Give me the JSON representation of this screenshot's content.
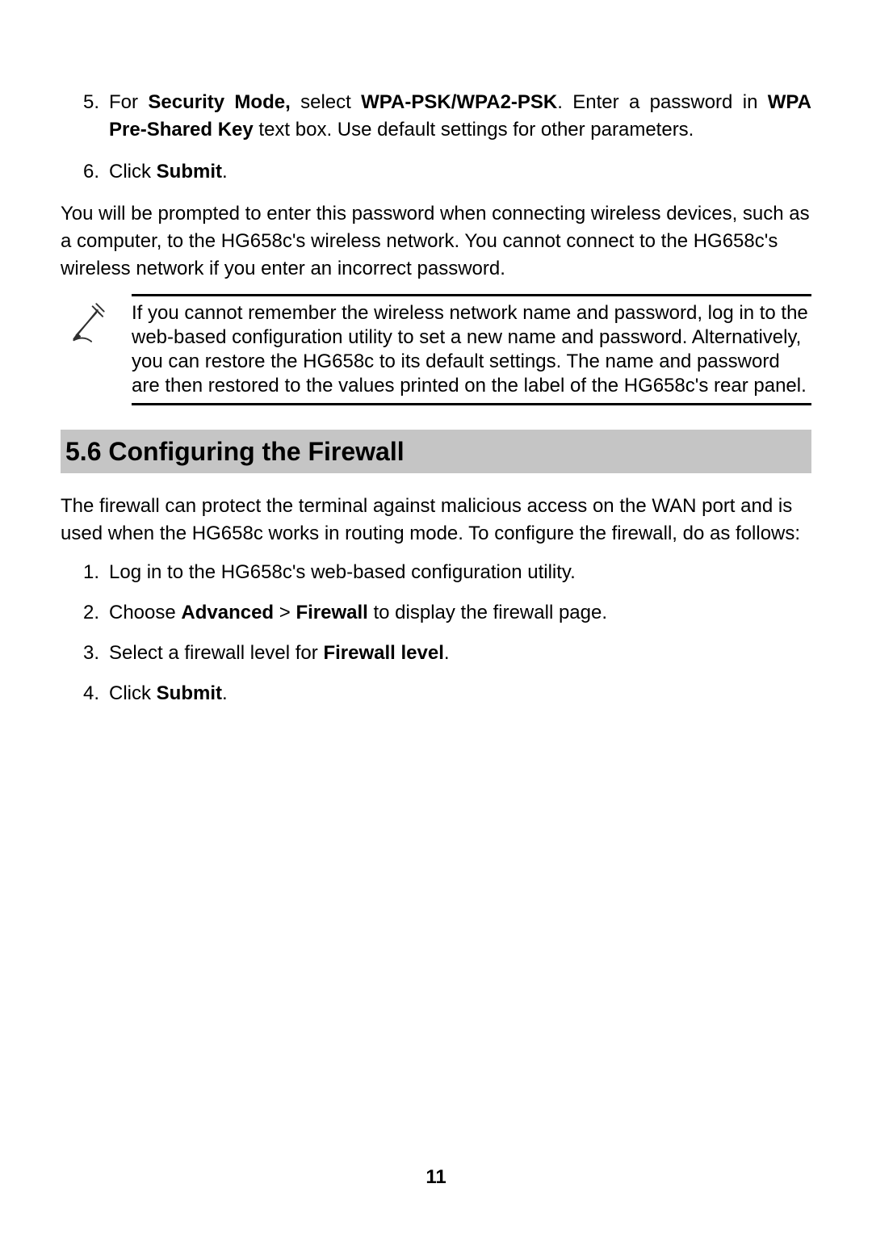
{
  "steps_top": [
    {
      "num": "5.",
      "runs": [
        {
          "t": "For "
        },
        {
          "t": "Security Mode,",
          "b": true
        },
        {
          "t": " select "
        },
        {
          "t": "WPA-PSK/WPA2-PSK",
          "b": true
        },
        {
          "t": ". Enter a password in "
        },
        {
          "t": "WPA Pre-Shared Key",
          "b": true
        },
        {
          "t": " text box. Use default settings for other parameters."
        }
      ],
      "justify": true
    },
    {
      "num": "6.",
      "runs": [
        {
          "t": "Click "
        },
        {
          "t": "Submit",
          "b": true
        },
        {
          "t": "."
        }
      ]
    }
  ],
  "body_para": "You will be prompted to enter this password when connecting wireless devices, such as a computer, to the HG658c's wireless network. You cannot connect to the HG658c's wireless network if you enter an incorrect password.",
  "note_text": "If you cannot remember the wireless network name and password, log in to the web-based configuration utility to set a new name and password. Alternatively, you can restore the HG658c to its default settings. The name and password are then restored to the values printed on the label of the HG658c's rear panel.",
  "section_heading": "5.6 Configuring the Firewall",
  "section_intro": "The firewall can protect the terminal against malicious access on the WAN port and is used when the HG658c works in routing mode. To configure the firewall, do as follows:",
  "steps_firewall": [
    {
      "num": "1.",
      "runs": [
        {
          "t": "Log in to the HG658c's web-based configuration utility."
        }
      ]
    },
    {
      "num": "2.",
      "runs": [
        {
          "t": "Choose "
        },
        {
          "t": "Advanced",
          "b": true
        },
        {
          "t": " > "
        },
        {
          "t": "Firewall",
          "b": true
        },
        {
          "t": " to display the firewall page."
        }
      ]
    },
    {
      "num": "3.",
      "runs": [
        {
          "t": "Select a firewall level for "
        },
        {
          "t": "Firewall level",
          "b": true
        },
        {
          "t": "."
        }
      ]
    },
    {
      "num": "4.",
      "runs": [
        {
          "t": "Click "
        },
        {
          "t": "Submit",
          "b": true
        },
        {
          "t": "."
        }
      ]
    }
  ],
  "page_number": "11"
}
